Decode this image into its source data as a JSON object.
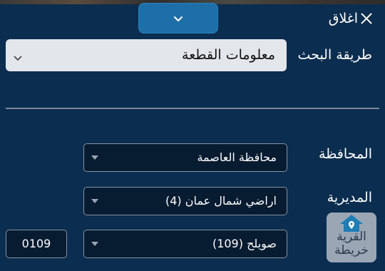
{
  "panel": {
    "close_label": "اغلاق"
  },
  "search_method": {
    "label": "طريقة البحث",
    "selected": "معلومات القطعة"
  },
  "governorate": {
    "label": "المحافظة",
    "selected": "محافظة العاصمة"
  },
  "directorate": {
    "label": "المديرية",
    "selected": "اراضي شمال عمان (4)"
  },
  "village": {
    "selected": "صويلح (109)",
    "code": "0109"
  },
  "map_button": {
    "line1": "القرية",
    "line2": "خريطة"
  },
  "colors": {
    "background": "#0b2d4f",
    "handle": "#1e6fa8",
    "field_dark": "#071b31",
    "field_light": "#e3e6ea"
  },
  "icons": {
    "handle": "chevron-down-icon",
    "close": "close-icon",
    "select": "caret-down-icon",
    "map": "home-icon"
  }
}
